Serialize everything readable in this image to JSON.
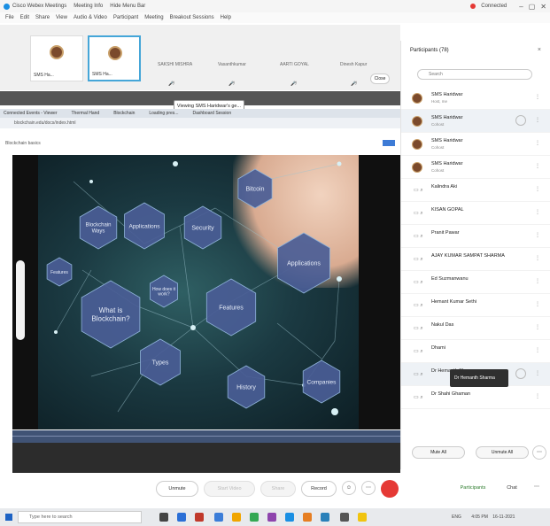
{
  "window": {
    "menus": [
      "Cisco Webex Meetings",
      "Meeting Info",
      "Hide Menu Bar"
    ],
    "recording_label": "Connected"
  },
  "menubar": [
    "File",
    "Edit",
    "Share",
    "View",
    "Audio & Video",
    "Participant",
    "Meeting",
    "Breakout Sessions",
    "Help"
  ],
  "strip": {
    "thumbnails": [
      {
        "name": "SMS Ha...",
        "active": false
      },
      {
        "name": "SMS Ha...",
        "active": true
      }
    ],
    "names": [
      "SAKSHI MISHRA",
      "Vasanthkumar",
      "AARTI GOYAL",
      "Dinesh Kapur"
    ],
    "close_label": "Close"
  },
  "share": {
    "label": "Viewing SMS Haridwar's ge..."
  },
  "browser": {
    "tabs": [
      "Connected Events - Viewer",
      "Thermal Hand",
      "Blockchain",
      "Loading pres...",
      "Dashboard Session"
    ],
    "url": "blockchain.edu/docs/index.html",
    "bookmark": "Blockchain basics"
  },
  "slide": {
    "hexes": [
      {
        "label": "Bitcoin"
      },
      {
        "label": "Security"
      },
      {
        "label": "Applications"
      },
      {
        "label": "Applications"
      },
      {
        "label": "Blockchain Ways"
      },
      {
        "label": "Features"
      },
      {
        "label": "What is Blockchain?"
      },
      {
        "label": "How does it work?"
      },
      {
        "label": "Features"
      },
      {
        "label": "Types"
      },
      {
        "label": "History"
      },
      {
        "label": "Companies"
      }
    ]
  },
  "controls": {
    "unmute": "Unmute",
    "start_video": "Start Video",
    "share": "Share",
    "record": "Record",
    "participants": "Participants",
    "chat": "Chat"
  },
  "taskbar": {
    "search_placeholder": "Type here to search",
    "time": "4:05 PM",
    "date": "16-11-2021",
    "lang": "ENG"
  },
  "panel": {
    "title": "Participants (78)",
    "search_placeholder": "Search",
    "participants": [
      {
        "name": "SMS Haridwar",
        "sub": "Host, me",
        "avatar": true
      },
      {
        "name": "SMS Haridwar",
        "sub": "Cohost",
        "avatar": true,
        "highlight": true
      },
      {
        "name": "SMS Haridwar",
        "sub": "Cohost",
        "avatar": true
      },
      {
        "name": "SMS Haridwar",
        "sub": "Cohost",
        "avatar": true
      },
      {
        "name": "Kalindra Aki",
        "sub": "",
        "avatar": false
      },
      {
        "name": "KISAN GOPAL",
        "sub": "",
        "avatar": false
      },
      {
        "name": "Pranit Pawar",
        "sub": "",
        "avatar": false
      },
      {
        "name": "AJAY KUMAR SAMPAT SHARMA",
        "sub": "",
        "avatar": false
      },
      {
        "name": "Ed Suzmanwanu",
        "sub": "",
        "avatar": false
      },
      {
        "name": "Hemant Kumar Sethi",
        "sub": "",
        "avatar": false
      },
      {
        "name": "Nakul Das",
        "sub": "",
        "avatar": false
      },
      {
        "name": "Dhami",
        "sub": "",
        "avatar": false
      },
      {
        "name": "Dr Hemanth Sharma",
        "sub": "",
        "avatar": false,
        "highlight": true
      },
      {
        "name": "Dr Shahi Ghaman",
        "sub": "",
        "avatar": false
      }
    ],
    "tooltip": "Dr Hemanth Sharma",
    "mute_all": "Mute All",
    "unmute_all": "Unmute All"
  }
}
